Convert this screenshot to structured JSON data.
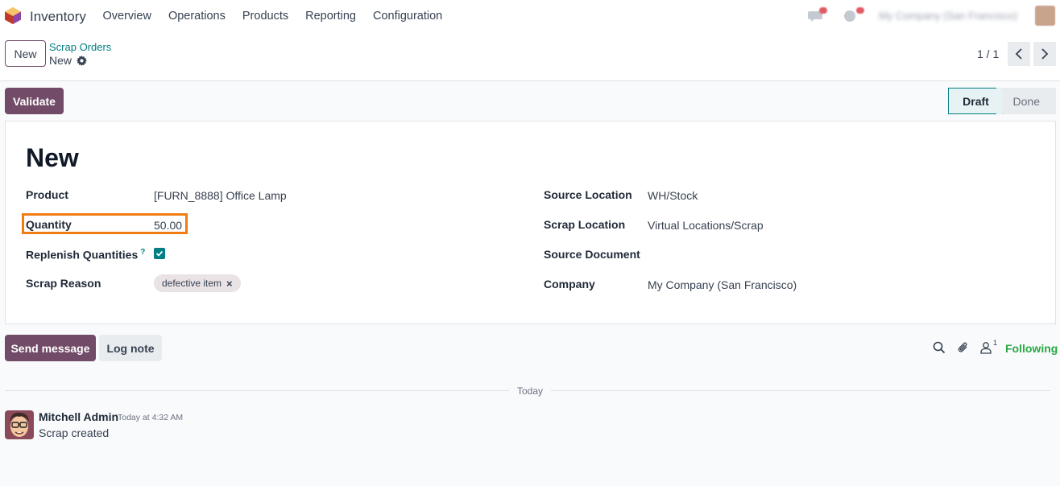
{
  "navbar": {
    "app_name": "Inventory",
    "menu": [
      "Overview",
      "Operations",
      "Products",
      "Reporting",
      "Configuration"
    ],
    "company": "My Company (San Francisco)"
  },
  "control_panel": {
    "new_label": "New",
    "breadcrumb_parent": "Scrap Orders",
    "breadcrumb_current": "New",
    "pager": "1 / 1"
  },
  "actions": {
    "validate_label": "Validate"
  },
  "statusbar": {
    "stages": [
      "Draft",
      "Done"
    ],
    "active": "Draft"
  },
  "form": {
    "title": "New",
    "product_label": "Product",
    "product_value": "[FURN_8888] Office Lamp",
    "quantity_label": "Quantity",
    "quantity_value": "50.00",
    "replenish_label": "Replenish Quantities",
    "replenish_help": "?",
    "replenish_checked": true,
    "reason_label": "Scrap Reason",
    "reason_tag": "defective item",
    "source_location_label": "Source Location",
    "source_location_value": "WH/Stock",
    "scrap_location_label": "Scrap Location",
    "scrap_location_value": "Virtual Locations/Scrap",
    "source_document_label": "Source Document",
    "source_document_value": "",
    "company_label": "Company",
    "company_value": "My Company (San Francisco)"
  },
  "chatter": {
    "send_message_label": "Send message",
    "log_note_label": "Log note",
    "follower_count": "1",
    "following_label": "Following",
    "date_separator": "Today",
    "messages": [
      {
        "author": "Mitchell Admin",
        "date": "Today at 4:32 AM",
        "body": "Scrap created"
      }
    ]
  },
  "colors": {
    "primary": "#714b67",
    "accent": "#017e84",
    "highlight": "#f07c12",
    "following": "#28a745"
  }
}
